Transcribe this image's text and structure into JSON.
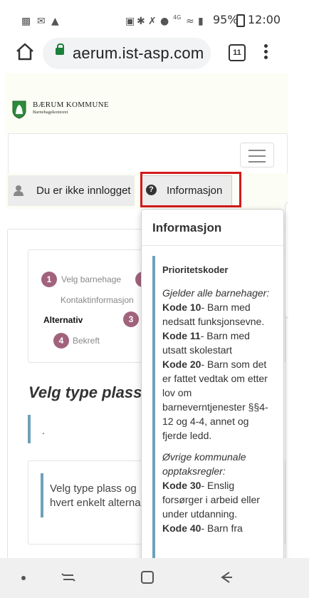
{
  "status_bar": {
    "battery": "95%",
    "time": "12:00",
    "network": "4G"
  },
  "browser": {
    "url": "aerum.ist-asp.com",
    "tab_count": "11"
  },
  "header": {
    "org_name": "BÆRUM KOMMUNE",
    "org_sub": "Barnehagekontoret"
  },
  "userbar": {
    "login_status": "Du er ikke innlogget",
    "info_label": "Informasjon"
  },
  "steps": [
    {
      "num": "1",
      "label": "Velg barnehage"
    },
    {
      "num": "2",
      "label": "Kontaktinformasjon"
    },
    {
      "num": "3",
      "label": "Alternativ"
    },
    {
      "num": "4",
      "label": "Bekreft"
    }
  ],
  "main": {
    "section_title": "Velg type plass",
    "dot_text": ".",
    "choice_line1": "Velg type plass og",
    "choice_line2": "hvert enkelt alterna"
  },
  "popover": {
    "title": "Informasjon",
    "prio_heading": "Prioritetskoder",
    "gjelder": "Gjelder alle barnehager:",
    "kode10": "Kode 10",
    "kode10_text": "- Barn med nedsatt funksjonsevne.",
    "kode11": "Kode 11",
    "kode11_text": "- Barn med utsatt skolestart",
    "kode20": "Kode 20",
    "kode20_text": "- Barn som det er fattet vedtak om etter lov om barneverntjenester §§4-12 og 4-4, annet og fjerde ledd.",
    "ovrige": "Øvrige kommunale opptaksregler:",
    "kode30": "Kode 30",
    "kode30_text": "- Enslig forsørger i arbeid eller under utdanning.",
    "kode40": "Kode 40",
    "kode40_text": "- Barn fra"
  }
}
